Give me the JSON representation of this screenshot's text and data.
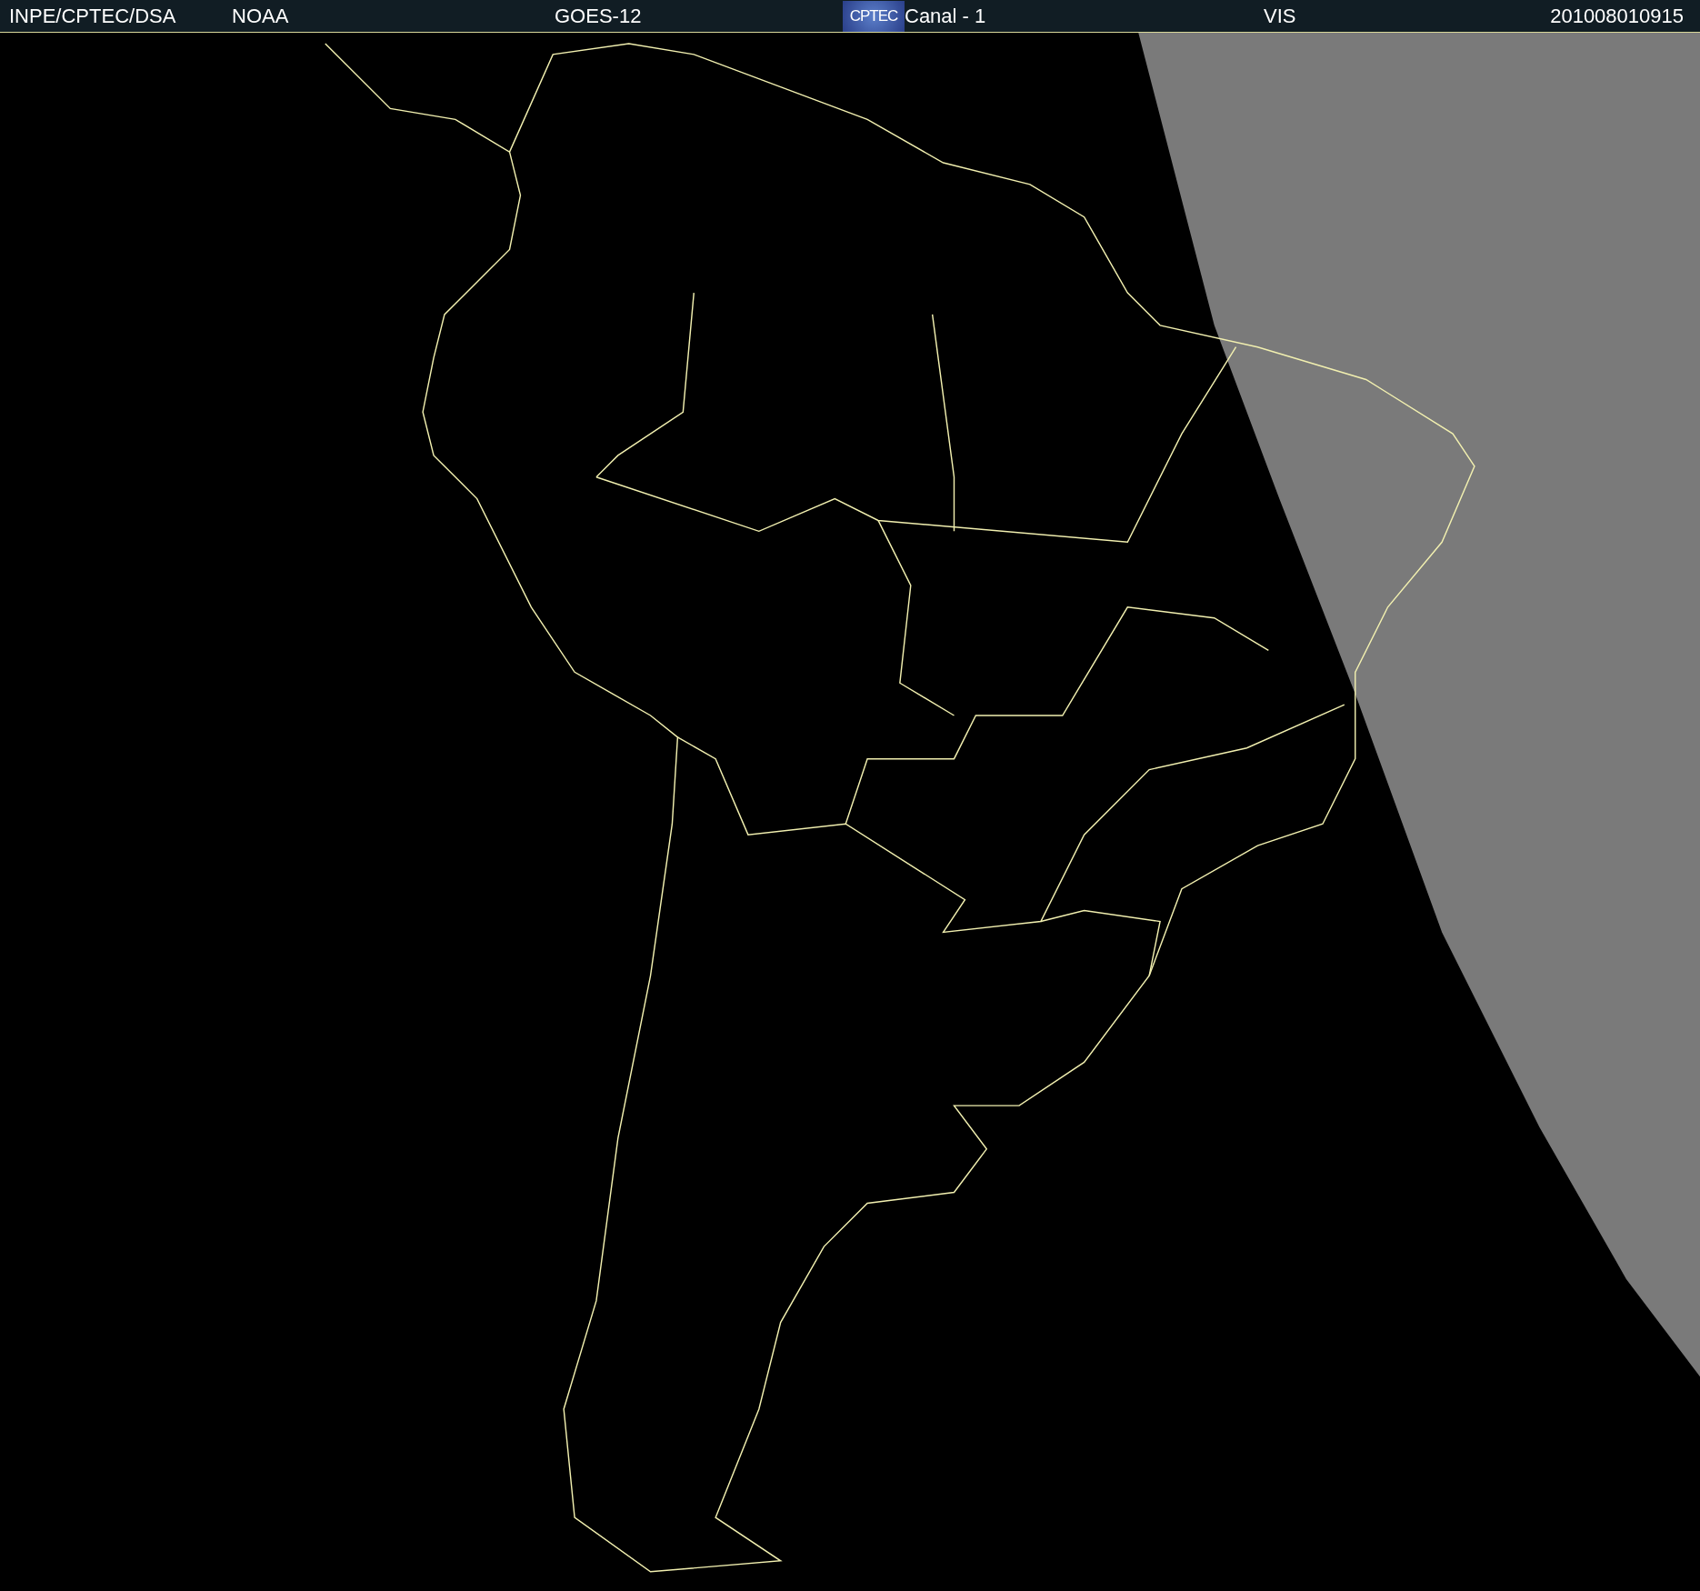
{
  "header": {
    "items": [
      {
        "kind": "text",
        "text": "INPE/CPTEC/DSA"
      },
      {
        "kind": "text",
        "text": "NOAA"
      },
      {
        "kind": "text",
        "text": "GOES-12"
      },
      {
        "kind": "logo",
        "text": "CPTEC"
      },
      {
        "kind": "text",
        "text": "Canal - 1"
      },
      {
        "kind": "text",
        "text": "VIS"
      },
      {
        "kind": "text",
        "text": "201008010915"
      }
    ]
  }
}
